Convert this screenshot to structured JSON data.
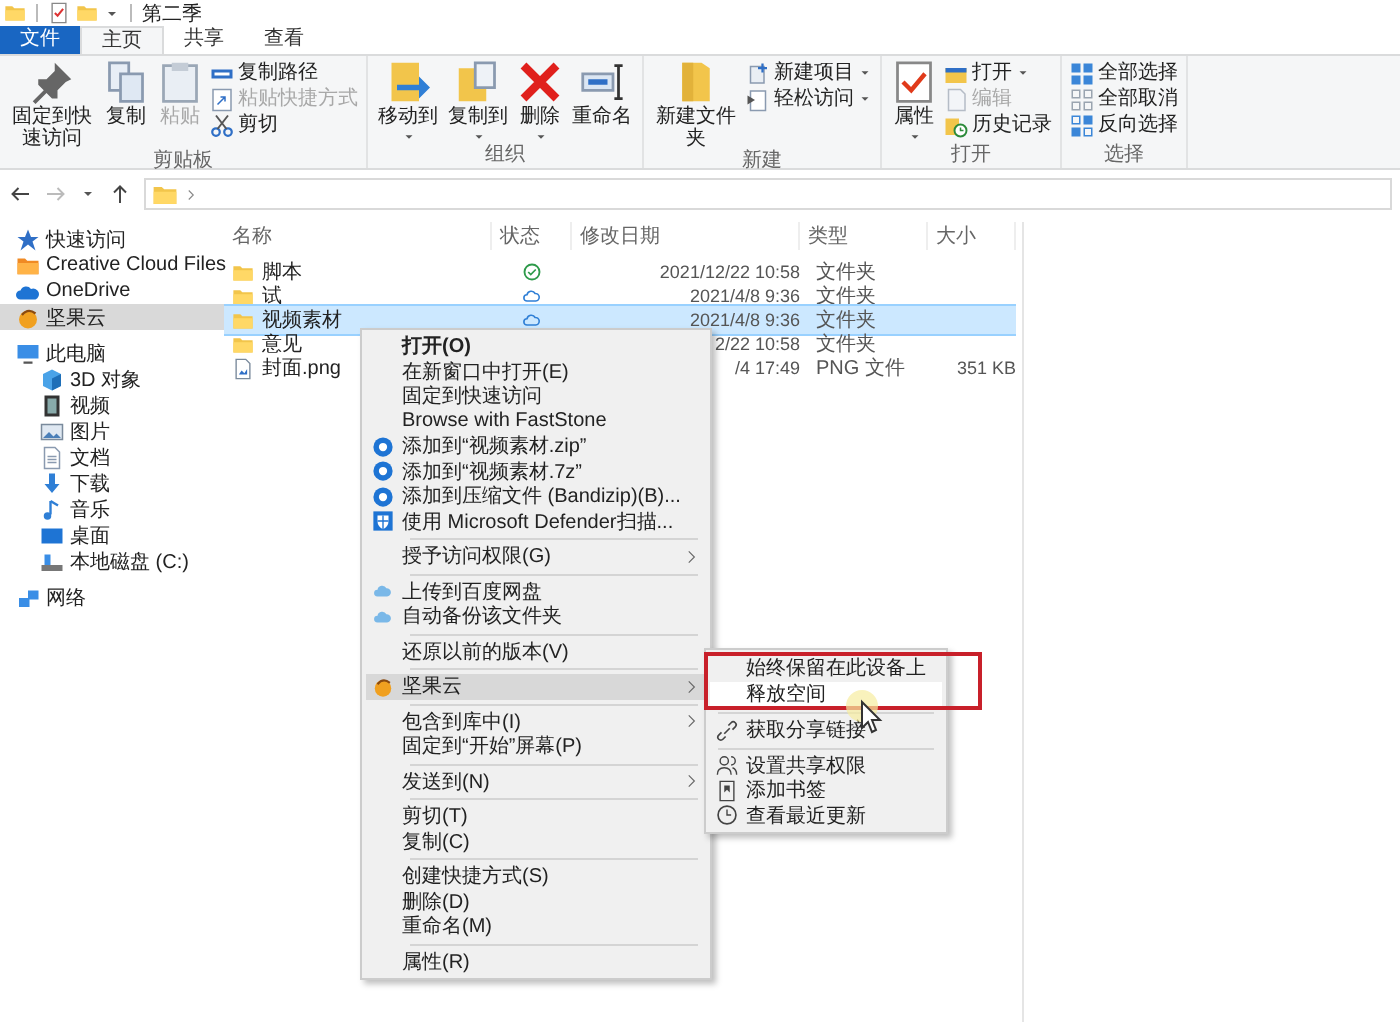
{
  "window": {
    "title": "第二季"
  },
  "tabs": [
    {
      "label": "文件",
      "kind": "file",
      "selected": false
    },
    {
      "label": "主页",
      "kind": "tab",
      "selected": true
    },
    {
      "label": "共享",
      "kind": "tab",
      "selected": false
    },
    {
      "label": "查看",
      "kind": "tab",
      "selected": false
    }
  ],
  "ribbon": {
    "groups": [
      {
        "label": "剪贴板",
        "buttons": [
          {
            "label": "固定到快速访问",
            "kind": "large",
            "disabled": false,
            "dropdown": false
          },
          {
            "label": "复制",
            "kind": "large",
            "disabled": false,
            "dropdown": false
          },
          {
            "label": "粘贴",
            "kind": "large",
            "disabled": true,
            "dropdown": false
          },
          {
            "label": "复制路径",
            "kind": "small",
            "disabled": false,
            "dropdown": false
          },
          {
            "label": "粘贴快捷方式",
            "kind": "small",
            "disabled": true,
            "dropdown": false
          },
          {
            "label": "剪切",
            "kind": "small",
            "disabled": false,
            "dropdown": false
          }
        ]
      },
      {
        "label": "组织",
        "buttons": [
          {
            "label": "移动到",
            "kind": "large",
            "disabled": false,
            "dropdown": true
          },
          {
            "label": "复制到",
            "kind": "large",
            "disabled": false,
            "dropdown": true
          },
          {
            "label": "删除",
            "kind": "large",
            "disabled": false,
            "dropdown": true
          },
          {
            "label": "重命名",
            "kind": "large",
            "disabled": false,
            "dropdown": false
          }
        ]
      },
      {
        "label": "新建",
        "buttons": [
          {
            "label": "新建文件夹",
            "kind": "large",
            "disabled": false,
            "dropdown": false
          },
          {
            "label": "新建项目",
            "kind": "small",
            "disabled": false,
            "dropdown": true
          },
          {
            "label": "轻松访问",
            "kind": "small",
            "disabled": false,
            "dropdown": true
          }
        ]
      },
      {
        "label": "打开",
        "buttons": [
          {
            "label": "属性",
            "kind": "large",
            "disabled": false,
            "dropdown": true
          },
          {
            "label": "打开",
            "kind": "small",
            "disabled": false,
            "dropdown": true
          },
          {
            "label": "编辑",
            "kind": "small",
            "disabled": true,
            "dropdown": false
          },
          {
            "label": "历史记录",
            "kind": "small",
            "disabled": false,
            "dropdown": false
          }
        ]
      },
      {
        "label": "选择",
        "buttons": [
          {
            "label": "全部选择",
            "kind": "small",
            "disabled": false,
            "dropdown": false
          },
          {
            "label": "全部取消",
            "kind": "small",
            "disabled": false,
            "dropdown": false
          },
          {
            "label": "反向选择",
            "kind": "small",
            "disabled": false,
            "dropdown": false
          }
        ]
      }
    ]
  },
  "sidebar": {
    "items": [
      {
        "label": "快速访问",
        "selected": false
      },
      {
        "label": "Creative Cloud Files",
        "selected": false
      },
      {
        "label": "OneDrive",
        "selected": false
      },
      {
        "label": "坚果云",
        "selected": true
      },
      {
        "label": "此电脑",
        "selected": false,
        "children": [
          {
            "label": "3D 对象",
            "selected": false
          },
          {
            "label": "视频",
            "selected": false
          },
          {
            "label": "图片",
            "selected": false
          },
          {
            "label": "文档",
            "selected": false
          },
          {
            "label": "下载",
            "selected": false
          },
          {
            "label": "音乐",
            "selected": false
          },
          {
            "label": "桌面",
            "selected": false
          },
          {
            "label": "本地磁盘 (C:)",
            "selected": false
          }
        ]
      },
      {
        "label": "网络",
        "selected": false
      }
    ]
  },
  "table": {
    "columns": [
      "名称",
      "状态",
      "修改日期",
      "类型",
      "大小"
    ],
    "rows": [
      {
        "kind": "folder",
        "name": "脚本",
        "synced": true,
        "cloud_only": false,
        "modified": "2021/12/22 10:58",
        "type": "文件夹",
        "selected": false
      },
      {
        "kind": "folder",
        "name": "试",
        "synced": false,
        "cloud_only": true,
        "modified": "2021/4/8 9:36",
        "type": "文件夹",
        "selected": false
      },
      {
        "kind": "folder",
        "name": "视频素材",
        "synced": false,
        "cloud_only": true,
        "modified": "2021/4/8 9:36",
        "type": "文件夹",
        "selected": true
      },
      {
        "kind": "folder",
        "name": "意见",
        "synced": false,
        "cloud_only": false,
        "modified": "2/22 10:58",
        "type": "文件夹",
        "selected": false
      },
      {
        "kind": "file",
        "name": "封面.png",
        "synced": false,
        "cloud_only": false,
        "modified": "/4 17:49",
        "type": "PNG 文件",
        "size": "351 KB",
        "selected": false
      }
    ]
  },
  "context_menu": {
    "groups": [
      [
        {
          "label": "打开(O)",
          "default": true,
          "submenu": false,
          "selected": false
        },
        {
          "label": "在新窗口中打开(E)",
          "default": false,
          "submenu": false,
          "selected": false
        },
        {
          "label": "固定到快速访问",
          "default": false,
          "submenu": false,
          "selected": false
        },
        {
          "label": "Browse with FastStone",
          "default": false,
          "submenu": false,
          "selected": false
        },
        {
          "label": "添加到“视频素材.zip”",
          "default": false,
          "submenu": false,
          "selected": false
        },
        {
          "label": "添加到“视频素材.7z”",
          "default": false,
          "submenu": false,
          "selected": false
        },
        {
          "label": "添加到压缩文件 (Bandizip)(B)...",
          "default": false,
          "submenu": false,
          "selected": false
        },
        {
          "label": "使用 Microsoft Defender扫描...",
          "default": false,
          "submenu": false,
          "selected": false
        }
      ],
      [
        {
          "label": "授予访问权限(G)",
          "default": false,
          "submenu": true,
          "selected": false
        }
      ],
      [
        {
          "label": "上传到百度网盘",
          "default": false,
          "submenu": false,
          "selected": false
        },
        {
          "label": "自动备份该文件夹",
          "default": false,
          "submenu": false,
          "selected": false
        }
      ],
      [
        {
          "label": "还原以前的版本(V)",
          "default": false,
          "submenu": false,
          "selected": false
        }
      ],
      [
        {
          "label": "坚果云",
          "default": false,
          "submenu": true,
          "selected": true
        }
      ],
      [
        {
          "label": "包含到库中(I)",
          "default": false,
          "submenu": true,
          "selected": false
        },
        {
          "label": "固定到“开始”屏幕(P)",
          "default": false,
          "submenu": false,
          "selected": false
        }
      ],
      [
        {
          "label": "发送到(N)",
          "default": false,
          "submenu": true,
          "selected": false
        }
      ],
      [
        {
          "label": "剪切(T)",
          "default": false,
          "submenu": false,
          "selected": false
        },
        {
          "label": "复制(C)",
          "default": false,
          "submenu": false,
          "selected": false
        }
      ],
      [
        {
          "label": "创建快捷方式(S)",
          "default": false,
          "submenu": false,
          "selected": false
        },
        {
          "label": "删除(D)",
          "default": false,
          "submenu": false,
          "selected": false
        },
        {
          "label": "重命名(M)",
          "default": false,
          "submenu": false,
          "selected": false
        }
      ],
      [
        {
          "label": "属性(R)",
          "default": false,
          "submenu": false,
          "selected": false
        }
      ]
    ]
  },
  "submenu": {
    "groups": [
      {
        "outlined": true,
        "items": [
          {
            "label": "始终保留在此设备上",
            "selected": false
          },
          {
            "label": "释放空间",
            "selected": true
          }
        ]
      },
      {
        "outlined": false,
        "items": [
          {
            "label": "获取分享链接",
            "selected": false
          }
        ]
      },
      {
        "outlined": false,
        "items": [
          {
            "label": "设置共享权限",
            "selected": false
          },
          {
            "label": "添加书签",
            "selected": false
          },
          {
            "label": "查看最近更新",
            "selected": false
          }
        ]
      }
    ]
  }
}
